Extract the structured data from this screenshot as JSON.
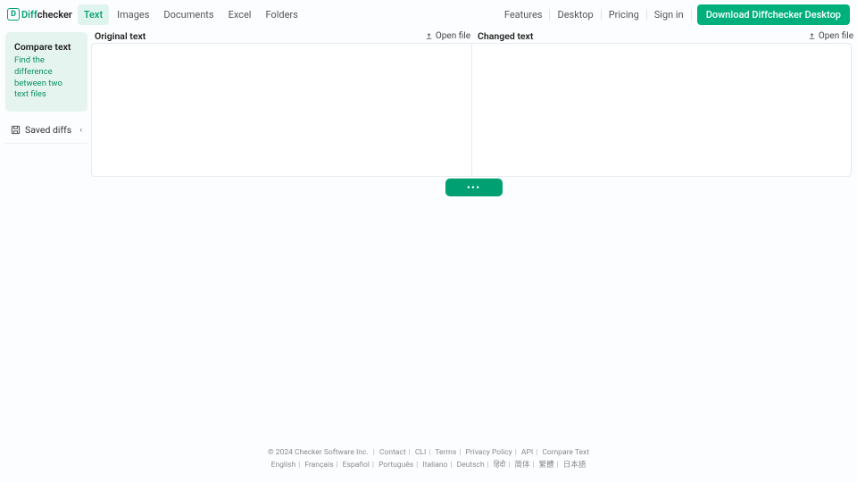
{
  "brand": {
    "badge": "D",
    "part1": "Diff",
    "part2": "checker"
  },
  "nav": {
    "left": [
      "Text",
      "Images",
      "Documents",
      "Excel",
      "Folders"
    ],
    "activeIndex": 0,
    "right": [
      "Features",
      "Desktop",
      "Pricing",
      "Sign in"
    ],
    "download": "Download Diffchecker Desktop"
  },
  "sidebar": {
    "panel": {
      "title": "Compare text",
      "desc": "Find the difference between two text files"
    },
    "saved": "Saved diffs"
  },
  "editor": {
    "left_label": "Original text",
    "right_label": "Changed text",
    "open_file": "Open file",
    "left_value": "",
    "right_value": "",
    "diff_button": "•••"
  },
  "footer": {
    "copyright": "© 2024 Checker Software Inc.",
    "links": [
      "Contact",
      "CLI",
      "Terms",
      "Privacy Policy",
      "API",
      "Compare Text"
    ],
    "langs": [
      "English",
      "Français",
      "Español",
      "Português",
      "Italiano",
      "Deutsch",
      "हिंदी",
      "简体",
      "繁體",
      "日本語"
    ]
  }
}
